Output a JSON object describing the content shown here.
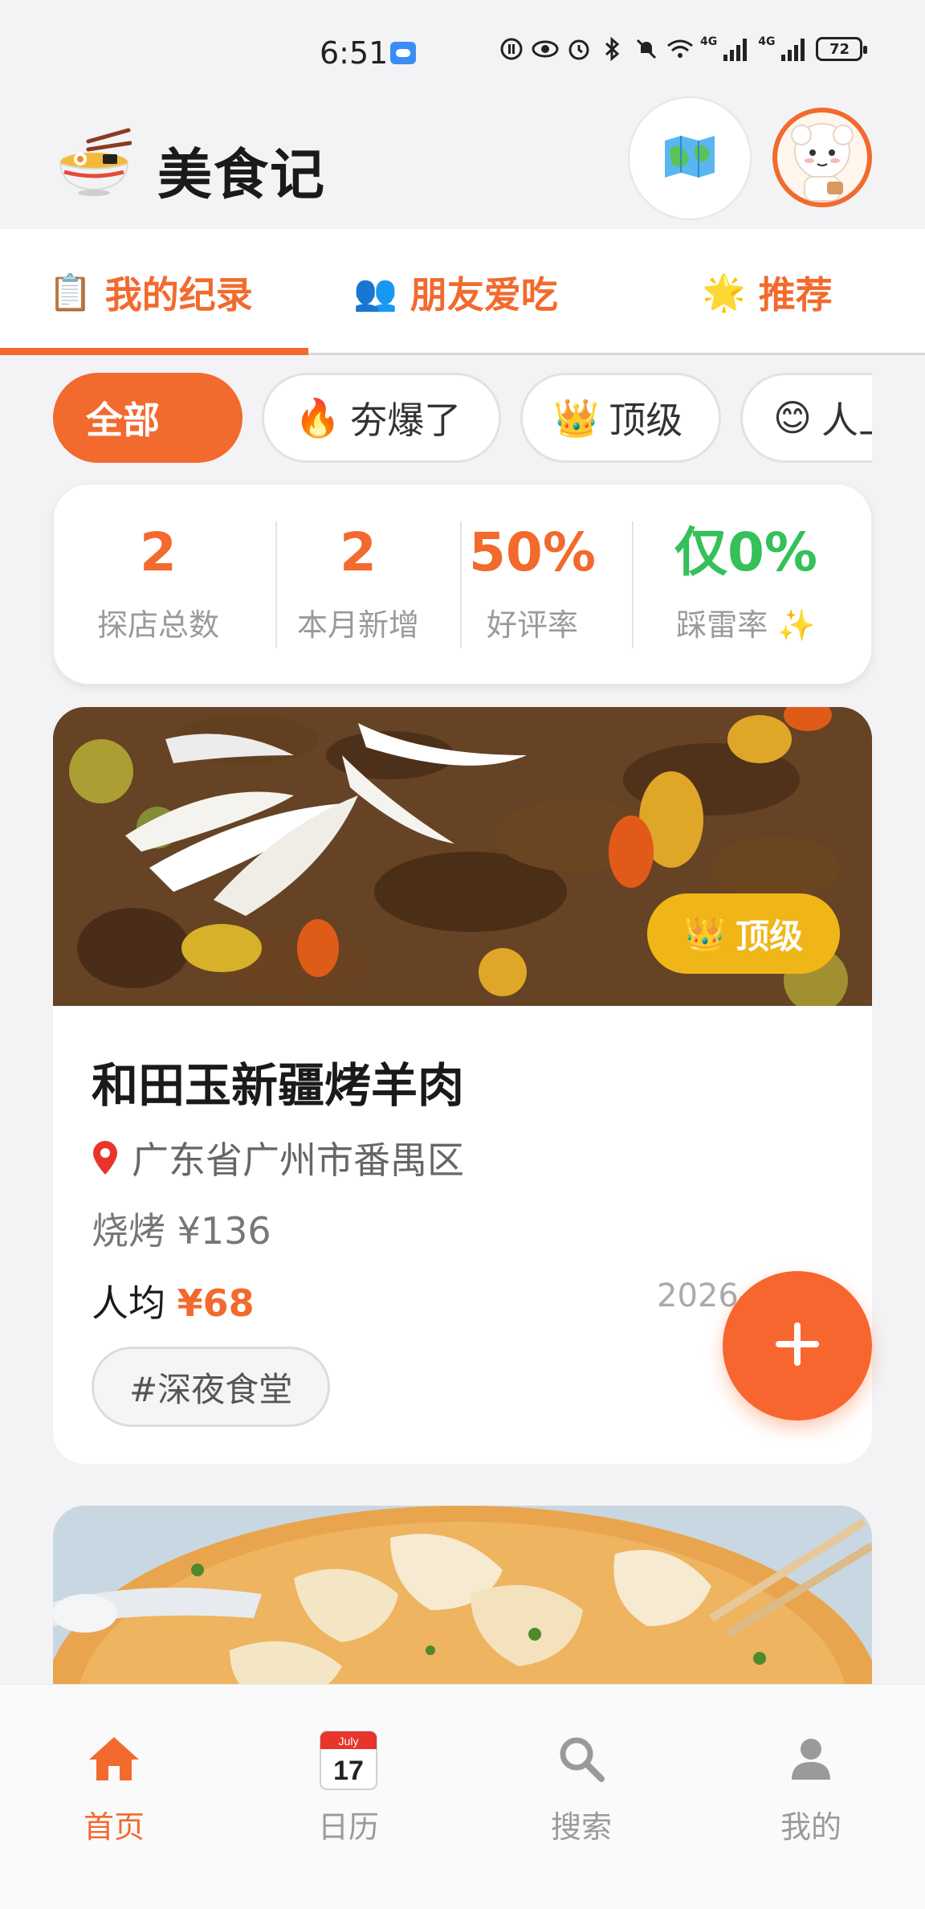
{
  "status_bar": {
    "time": "6:51",
    "battery": "72",
    "net1": "4G",
    "net2": "4G"
  },
  "header": {
    "app_title": "美食记",
    "logo_icon": "noodle-bowl-icon",
    "map_icon": "map-icon",
    "avatar_icon": "sheep-avatar"
  },
  "tabs": [
    {
      "icon": "📋",
      "label": "我的纪录",
      "active": true
    },
    {
      "icon": "👥",
      "label": "朋友爱吃",
      "active": false
    },
    {
      "icon": "🌟",
      "label": "推荐",
      "active": false
    }
  ],
  "filters": [
    {
      "icon": "",
      "label": "全部",
      "active": true
    },
    {
      "icon": "🔥",
      "label": "夯爆了",
      "active": false
    },
    {
      "icon": "👑",
      "label": "顶级",
      "active": false
    },
    {
      "icon": "😊",
      "label": "人上人",
      "active": false
    }
  ],
  "stats": [
    {
      "value": "2",
      "label": "探店总数"
    },
    {
      "value": "2",
      "label": "本月新增"
    },
    {
      "value": "50%",
      "label": "好评率"
    },
    {
      "value": "仅0%",
      "label": "踩雷率 ✨"
    }
  ],
  "colors": {
    "accent": "#f26a2e",
    "green": "#35c05a",
    "badge_gold": "#f0b618"
  },
  "card": {
    "badge_icon": "👑",
    "badge": "顶级",
    "title": "和田玉新疆烤羊肉",
    "location_icon": "pin-icon",
    "location": "广东省广州市番禺区",
    "dish": "烧烤 ¥136",
    "price_label": "人均 ",
    "price_value": "¥68",
    "date": "2026-",
    "tag": "#深夜食堂"
  },
  "fab_icon": "plus-icon",
  "bottom_nav": [
    {
      "label": "首页",
      "icon": "home-icon",
      "active": true
    },
    {
      "label": "日历",
      "icon": "calendar-icon",
      "active": false,
      "cal_month": "July",
      "cal_day": "17"
    },
    {
      "label": "搜索",
      "icon": "search-icon",
      "active": false
    },
    {
      "label": "我的",
      "icon": "person-icon",
      "active": false
    }
  ]
}
